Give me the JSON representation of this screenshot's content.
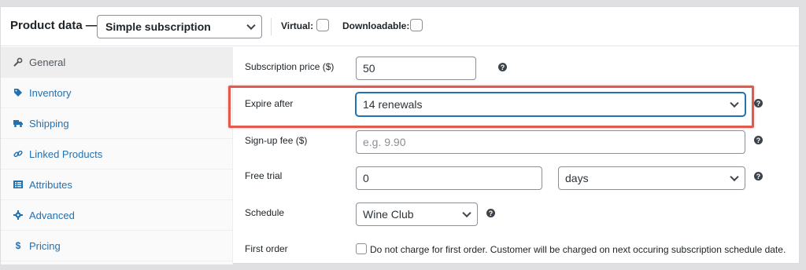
{
  "header": {
    "title": "Product data —",
    "product_type": "Simple subscription",
    "virtual_label": "Virtual:",
    "downloadable_label": "Downloadable:"
  },
  "sidebar": {
    "items": [
      {
        "label": "General",
        "icon": "wrench-icon",
        "active": true
      },
      {
        "label": "Inventory",
        "icon": "tag-icon",
        "active": false
      },
      {
        "label": "Shipping",
        "icon": "truck-icon",
        "active": false
      },
      {
        "label": "Linked Products",
        "icon": "link-icon",
        "active": false
      },
      {
        "label": "Attributes",
        "icon": "list-icon",
        "active": false
      },
      {
        "label": "Advanced",
        "icon": "gear-icon",
        "active": false
      },
      {
        "label": "Pricing",
        "icon": "dollar-icon",
        "active": false
      }
    ]
  },
  "fields": {
    "subscription_price": {
      "label": "Subscription price ($)",
      "value": "50"
    },
    "expire_after": {
      "label": "Expire after",
      "value": "14 renewals"
    },
    "signup_fee": {
      "label": "Sign-up fee ($)",
      "placeholder": "e.g. 9.90"
    },
    "free_trial": {
      "label": "Free trial",
      "value": "0",
      "unit": "days"
    },
    "schedule": {
      "label": "Schedule",
      "value": "Wine Club"
    },
    "first_order": {
      "label": "First order",
      "checkbox_text": "Do not charge for first order. Customer will be charged on next occuring subscription schedule date."
    }
  },
  "help_glyph": "?",
  "colors": {
    "link": "#2271b1",
    "highlight": "#e05a4e",
    "background": "#e0e0e3"
  }
}
